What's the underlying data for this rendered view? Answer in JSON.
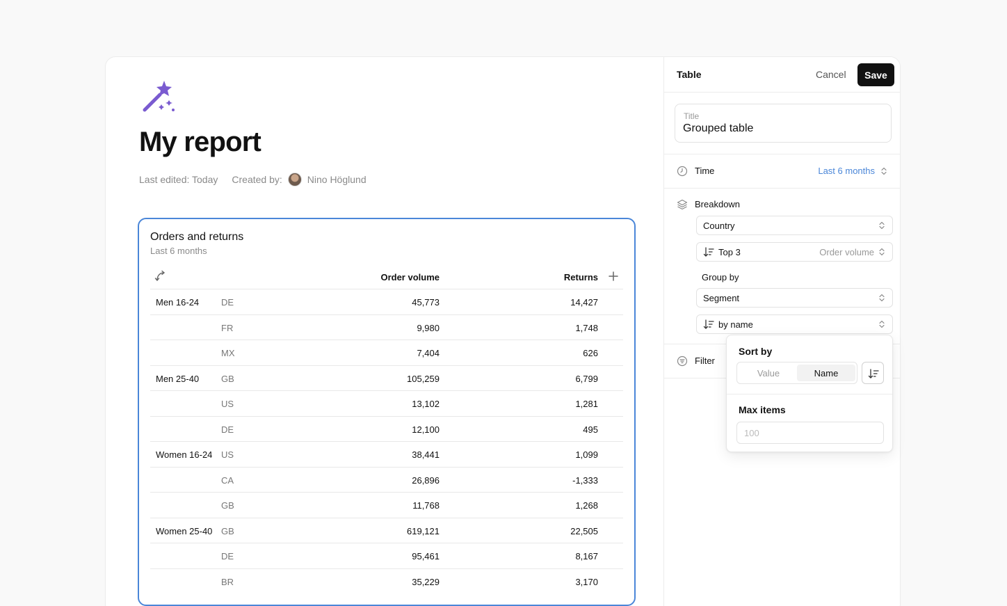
{
  "report": {
    "title": "My report",
    "last_edited": "Last edited: Today",
    "created_by_label": "Created by:",
    "author": "Nino Höglund"
  },
  "table": {
    "title": "Orders and returns",
    "subtitle": "Last 6 months",
    "columns": {
      "order_volume": "Order volume",
      "returns": "Returns"
    },
    "rows": [
      {
        "segment": "Men 16-24",
        "country": "DE",
        "order_volume": "45,773",
        "returns": "14,427"
      },
      {
        "segment": "",
        "country": "FR",
        "order_volume": "9,980",
        "returns": "1,748"
      },
      {
        "segment": "",
        "country": "MX",
        "order_volume": "7,404",
        "returns": "626"
      },
      {
        "segment": "Men 25-40",
        "country": "GB",
        "order_volume": "105,259",
        "returns": "6,799"
      },
      {
        "segment": "",
        "country": "US",
        "order_volume": "13,102",
        "returns": "1,281"
      },
      {
        "segment": "",
        "country": "DE",
        "order_volume": "12,100",
        "returns": "495"
      },
      {
        "segment": "Women 16-24",
        "country": "US",
        "order_volume": "38,441",
        "returns": "1,099"
      },
      {
        "segment": "",
        "country": "CA",
        "order_volume": "26,896",
        "returns": "-1,333"
      },
      {
        "segment": "",
        "country": "GB",
        "order_volume": "11,768",
        "returns": "1,268"
      },
      {
        "segment": "Women 25-40",
        "country": "GB",
        "order_volume": "619,121",
        "returns": "22,505"
      },
      {
        "segment": "",
        "country": "DE",
        "order_volume": "95,461",
        "returns": "8,167"
      },
      {
        "segment": "",
        "country": "BR",
        "order_volume": "35,229",
        "returns": "3,170"
      }
    ]
  },
  "panel": {
    "header": "Table",
    "cancel_label": "Cancel",
    "save_label": "Save",
    "title_field": {
      "label": "Title",
      "value": "Grouped table"
    },
    "time": {
      "label": "Time",
      "value": "Last 6 months"
    },
    "breakdown": {
      "label": "Breakdown",
      "dimension": "Country",
      "limit": "Top 3",
      "limit_metric": "Order volume",
      "group_by_label": "Group by",
      "group_by": "Segment",
      "group_sort": "by name"
    },
    "filter": {
      "label": "Filter"
    }
  },
  "popover": {
    "sort_by_label": "Sort by",
    "options": [
      "Value",
      "Name"
    ],
    "selected": "Name",
    "max_items_label": "Max items",
    "max_items_placeholder": "100"
  },
  "colors": {
    "accent": "#4a86d8",
    "brand": "#7a5bd0",
    "primary_button": "#111111"
  }
}
